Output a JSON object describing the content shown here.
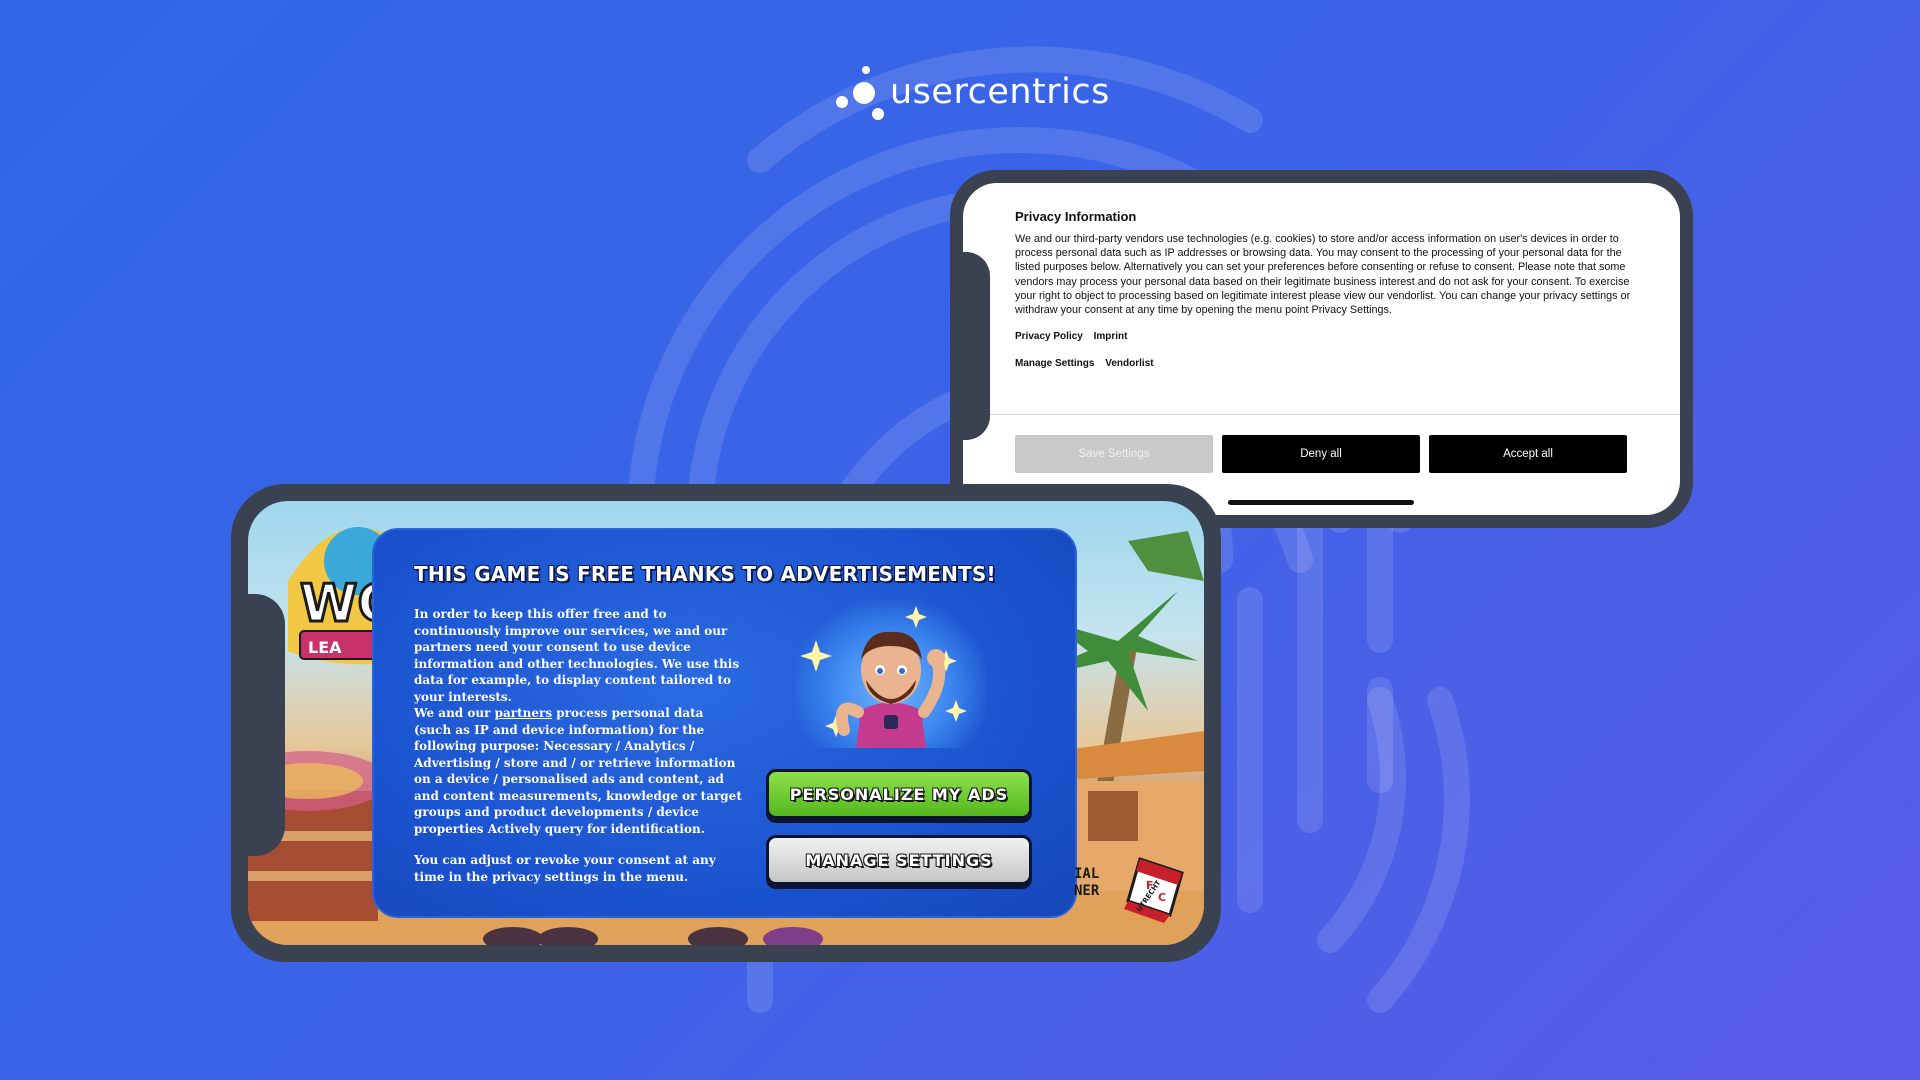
{
  "brand": {
    "logo_text": "usercentrics",
    "background_color": "#3d63e8"
  },
  "privacy_dialog": {
    "title": "Privacy Information",
    "body": "We and our third-party vendors use technologies (e.g. cookies) to store and/or access information on user's devices in order to process personal data such as IP addresses or browsing data. You may consent to the processing of your personal data for the listed purposes below. Alternatively you can set your preferences before consenting or refuse to consent. Please note that some vendors may process your personal data based on their legitimate business interest and do not ask for your consent. To exercise your right to object to processing based on legitimate interest please view our vendorlist. You can change your privacy settings or withdraw your consent at any time by opening the menu point Privacy Settings.",
    "links_row1": [
      "Privacy Policy",
      "Imprint"
    ],
    "links_row2": [
      "Manage Settings",
      "Vendorlist"
    ],
    "buttons": {
      "save": "Save Settings",
      "deny": "Deny all",
      "accept": "Accept all"
    }
  },
  "game_dialog": {
    "title": "THIS GAME IS FREE THANKS TO ADVERTISEMENTS!",
    "para1": "In order to keep this offer free and to continuously improve our services, we and our partners need your consent to use device information and other technologies. We use this data for example, to display content tailored to your interests.",
    "para2_before": "We and our ",
    "para2_link": "partners",
    "para2_after": " process personal data (such as IP and device information) for the following purpose: Necessary / Analytics / Advertising / store and / or retrieve information on a device / personalised ads and content, ad and content measurements, knowledge or target groups and product developments / device properties Actively query for identification.",
    "para3": "You can adjust or revoke your consent at any time in the privacy settings in the menu.",
    "buttons": {
      "personalize": "PERSONALIZE MY ADS",
      "manage": "MANAGE SETTINGS"
    }
  },
  "game_scene": {
    "logo_partial": "WO",
    "logo_sub_partial": "LEA",
    "sponsor_line1": "IAL",
    "sponsor_line2": "NER",
    "club_letters": [
      "F",
      "C",
      "UTRECHT"
    ]
  }
}
